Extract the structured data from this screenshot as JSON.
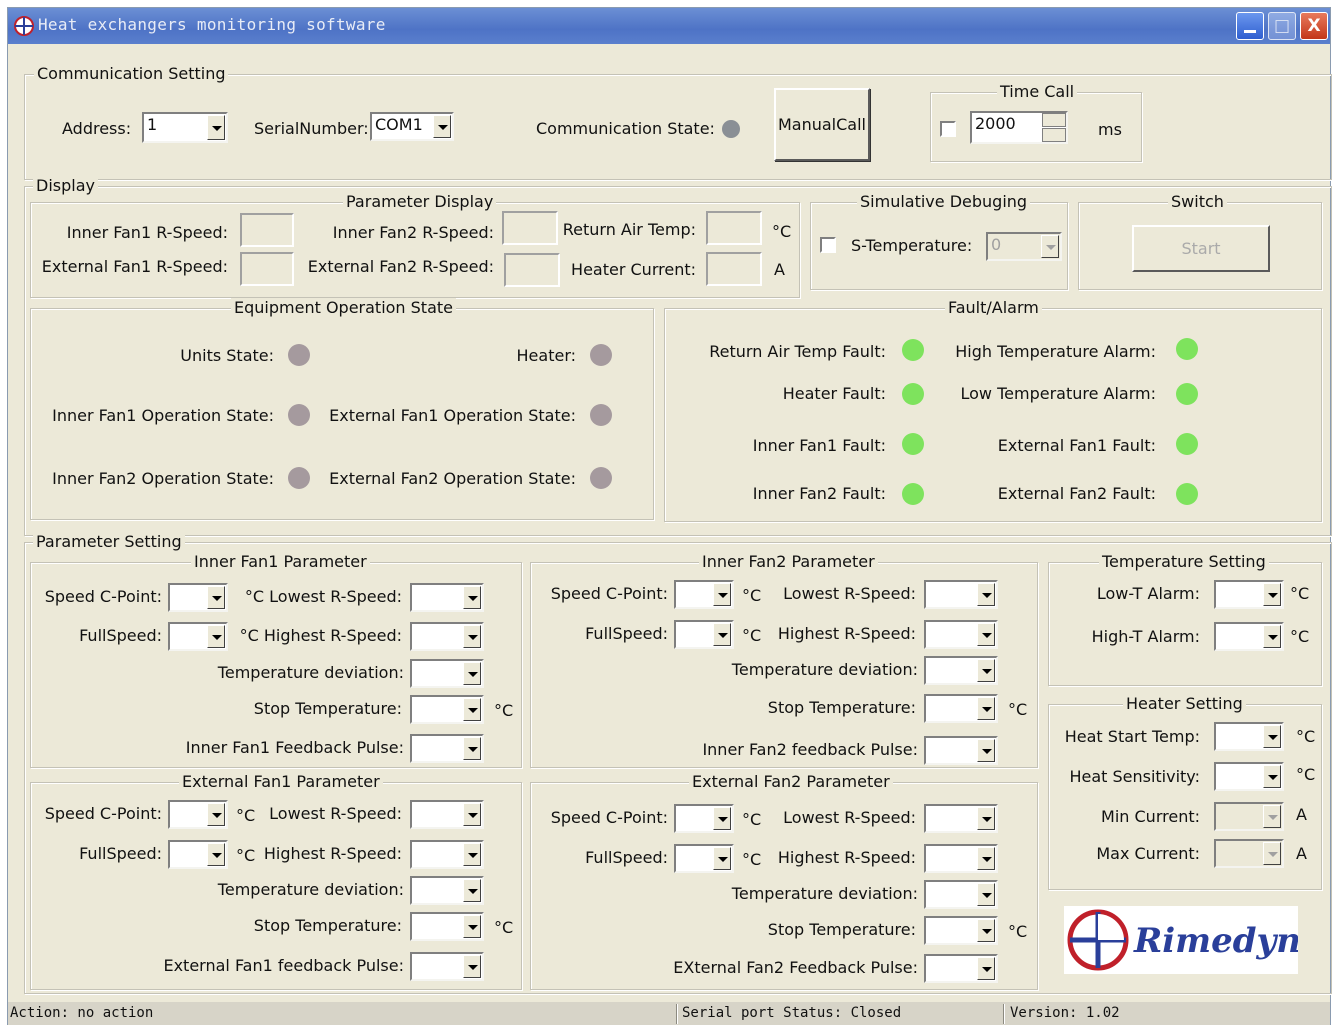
{
  "window": {
    "title": "Heat exchangers monitoring software",
    "minimize": "_",
    "maximize": "□",
    "close": "X"
  },
  "communication": {
    "legend": "Communication Setting",
    "address_label": "Address:",
    "address_value": "1",
    "serial_label": "SerialNumber:",
    "serial_value": "COM1",
    "state_label": "Communication State:",
    "manual_call": "ManualCall",
    "time_call": {
      "legend": "Time Call",
      "value": "2000",
      "unit": "ms"
    }
  },
  "display": {
    "legend": "Display",
    "param_display": {
      "legend": "Parameter Display",
      "inner_fan1": "Inner Fan1 R-Speed:",
      "external_fan1": "External Fan1 R-Speed:",
      "inner_fan2": "Inner Fan2 R-Speed:",
      "external_fan2": "External Fan2 R-Speed:",
      "return_air": "Return Air Temp:",
      "heater_current": "Heater Current:",
      "unit_c": "°C",
      "unit_a": "A"
    },
    "simulative": {
      "legend": "Simulative Debuging",
      "s_temp": "S-Temperature:",
      "s_temp_value": "0"
    },
    "switch": {
      "legend": "Switch",
      "start": "Start"
    },
    "equipment": {
      "legend": "Equipment Operation State",
      "units": "Units State:",
      "heater": "Heater:",
      "inner_fan1": "Inner Fan1 Operation State:",
      "external_fan1": "External Fan1 Operation State:",
      "inner_fan2": "Inner Fan2 Operation State:",
      "external_fan2": "External Fan2 Operation State:"
    },
    "fault": {
      "legend": "Fault/Alarm",
      "return_air": "Return Air Temp Fault:",
      "high_temp": "High Temperature Alarm:",
      "heater": "Heater Fault:",
      "low_temp": "Low Temperature Alarm:",
      "inner_fan1": "Inner Fan1 Fault:",
      "external_fan1": "External Fan1 Fault:",
      "inner_fan2": "Inner Fan2 Fault:",
      "external_fan2": "External Fan2 Fault:"
    }
  },
  "params": {
    "legend": "Parameter Setting",
    "inner_fan1": {
      "legend": "Inner Fan1 Parameter",
      "speed_cpoint": "Speed C-Point:",
      "fullspeed": "FullSpeed:",
      "lowest": "°C Lowest R-Speed:",
      "highest": "°C Highest R-Speed:",
      "temp_dev": "Temperature deviation:",
      "stop_temp": "Stop Temperature:",
      "feedback": "Inner Fan1 Feedback Pulse:",
      "unit_c": "°C"
    },
    "inner_fan2": {
      "legend": "Inner Fan2 Parameter",
      "speed_cpoint": "Speed C-Point:",
      "fullspeed": "FullSpeed:",
      "unit1": "°C",
      "lowest": "Lowest R-Speed:",
      "unit2": "°C",
      "highest": "Highest R-Speed:",
      "temp_dev": "Temperature deviation:",
      "stop_temp": "Stop Temperature:",
      "feedback": "Inner Fan2 feedback Pulse:",
      "unit_c": "°C"
    },
    "external_fan1": {
      "legend": "External Fan1 Parameter",
      "speed_cpoint": "Speed C-Point:",
      "fullspeed": "FullSpeed:",
      "unit1": "°C",
      "lowest": "Lowest R-Speed:",
      "unit2": "°C",
      "highest": "Highest R-Speed:",
      "temp_dev": "Temperature deviation:",
      "stop_temp": "Stop Temperature:",
      "feedback": "External Fan1 feedback Pulse:",
      "unit_c": "°C"
    },
    "external_fan2": {
      "legend": "External Fan2 Parameter",
      "speed_cpoint": "Speed C-Point:",
      "fullspeed": "FullSpeed:",
      "unit1": "°C",
      "lowest": "Lowest R-Speed:",
      "unit2": "°C",
      "highest": "Highest R-Speed:",
      "temp_dev": "Temperature deviation:",
      "stop_temp": "Stop Temperature:",
      "feedback": "EXternal Fan2 Feedback Pulse:",
      "unit_c": "°C"
    },
    "temperature": {
      "legend": "Temperature Setting",
      "low_t": "Low-T Alarm:",
      "high_t": "High-T Alarm:",
      "unit_c": "°C"
    },
    "heater": {
      "legend": "Heater Setting",
      "start_temp": "Heat Start Temp:",
      "sensitivity": "Heat Sensitivity:",
      "min_current": "Min Current:",
      "max_current": "Max Current:",
      "unit_c": "°C",
      "unit_a": "A"
    }
  },
  "logo": {
    "text": "Rimedyne"
  },
  "status": {
    "action": "Action: no action",
    "serial": "Serial port Status: Closed",
    "version": "Version: 1.02"
  },
  "colors": {
    "led_ok": "#7ee35d",
    "led_idle": "#a59a9e",
    "titlebar": "#4e73c6"
  }
}
